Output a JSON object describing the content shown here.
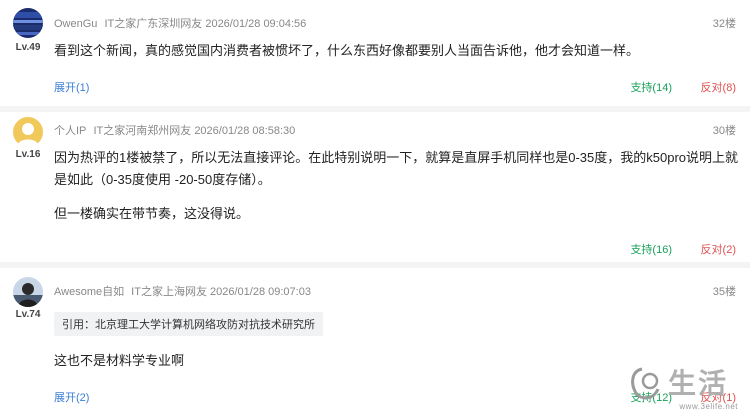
{
  "comments": [
    {
      "nick": "OwenGu",
      "source": "IT之家广东深圳网友",
      "time": "2026/01/28 09:04:56",
      "floor": "32楼",
      "level": "Lv.49",
      "text": [
        "看到这个新闻，真的感觉国内消费者被惯坏了，什么东西好像都要别人当面告诉他，他才会知道一样。"
      ],
      "expand": "展开(1)",
      "support": "支持(14)",
      "oppose": "反对(8)"
    },
    {
      "nick": "个人IP",
      "source": "IT之家河南郑州网友",
      "time": "2026/01/28 08:58:30",
      "floor": "30楼",
      "level": "Lv.16",
      "text": [
        "因为热评的1楼被禁了，所以无法直接评论。在此特别说明一下，就算是直屏手机同样也是0-35度，我的k50pro说明上就是如此（0-35度使用 -20-50度存储）。",
        "但一楼确实在带节奏，这没得说。"
      ],
      "support": "支持(16)",
      "oppose": "反对(2)"
    },
    {
      "nick": "Awesome自如",
      "source": "IT之家上海网友",
      "time": "2026/01/28 09:07:03",
      "floor": "35楼",
      "level": "Lv.74",
      "quote": "引用：北京理工大学计算机网络攻防对抗技术研究所",
      "text": [
        "这也不是材料学专业啊"
      ],
      "expand": "展开(2)",
      "support": "支持(12)",
      "oppose": "反对(1)"
    }
  ],
  "watermark": {
    "text": "www.3elife.net",
    "logo_chars": "生活",
    "colors": {
      "logo": "#9a9a9a"
    }
  },
  "colors": {
    "link": "#3d7fd6",
    "support": "#18a058",
    "oppose": "#e05050",
    "meta": "#888888"
  },
  "icons": [
    "avatar-icon",
    "watermark-logo-icon"
  ]
}
